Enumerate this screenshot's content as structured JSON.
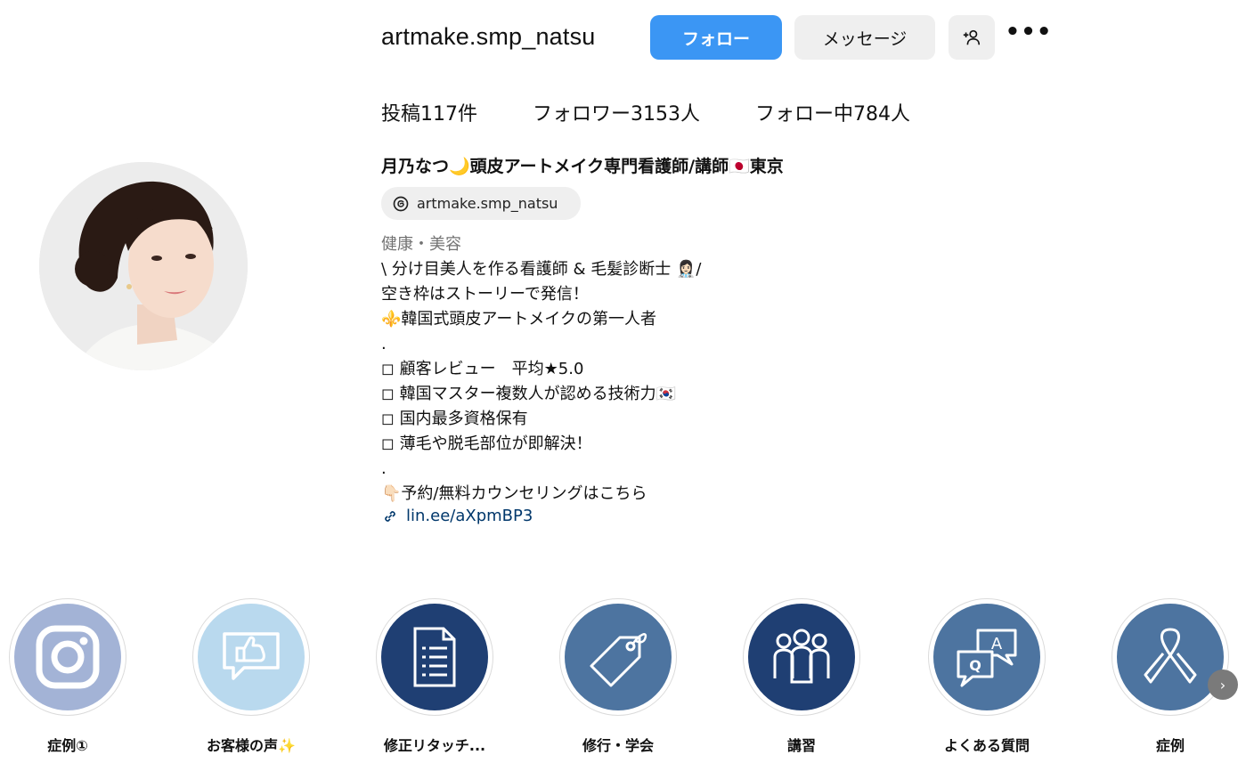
{
  "profile": {
    "username": "artmake.smp_natsu",
    "full_name": "月乃なつ🌙頭皮アートメイク専門看護師/講師🇯🇵東京",
    "threads_handle": "artmake.smp_natsu",
    "category": "健康・美容",
    "link": "lin.ee/aXpmBP3"
  },
  "actions": {
    "follow_label": "フォロー",
    "message_label": "メッセージ",
    "suggest_icon": "person-add-icon",
    "more_label": "•••"
  },
  "stats": {
    "posts": "投稿117件",
    "followers": "フォロワー3153人",
    "following": "フォロー中784人"
  },
  "bio": [
    "\\ 分け目美人を作る看護師 & 毛髪診断士 👩🏻‍⚕️/",
    "空き枠はストーリーで発信！",
    "⚜️韓国式頭皮アートメイクの第一人者",
    ".",
    "◻︎ 顧客レビュー　平均★5.0",
    "◻︎ 韓国マスター複数人が認める技術力🇰🇷",
    "◻︎ 国内最多資格保有",
    "◻︎ 薄毛や脱毛部位が即解決！",
    ".",
    "👇🏻予約/無料カウンセリングはこちら"
  ],
  "highlights": [
    {
      "label": "症例①",
      "icon": "instagram-icon",
      "color": "#a3b3d6"
    },
    {
      "label": "お客様の声✨",
      "icon": "thumbs-up-bubble-icon",
      "color": "#b9d9ee"
    },
    {
      "label": "修正リタッチ...",
      "icon": "document-list-icon",
      "color": "#1f3f73"
    },
    {
      "label": "修行・学会",
      "icon": "price-tag-icon",
      "color": "#4d74a0"
    },
    {
      "label": "講習",
      "icon": "group-people-icon",
      "color": "#1f3f73"
    },
    {
      "label": "よくある質問",
      "icon": "qa-bubbles-icon",
      "color": "#4d74a0"
    },
    {
      "label": "症例",
      "icon": "ribbon-icon",
      "color": "#4d74a0"
    }
  ],
  "colors": {
    "follow_button": "#3b96f4",
    "link_text": "#00376b",
    "secondary_button": "#efefef"
  }
}
